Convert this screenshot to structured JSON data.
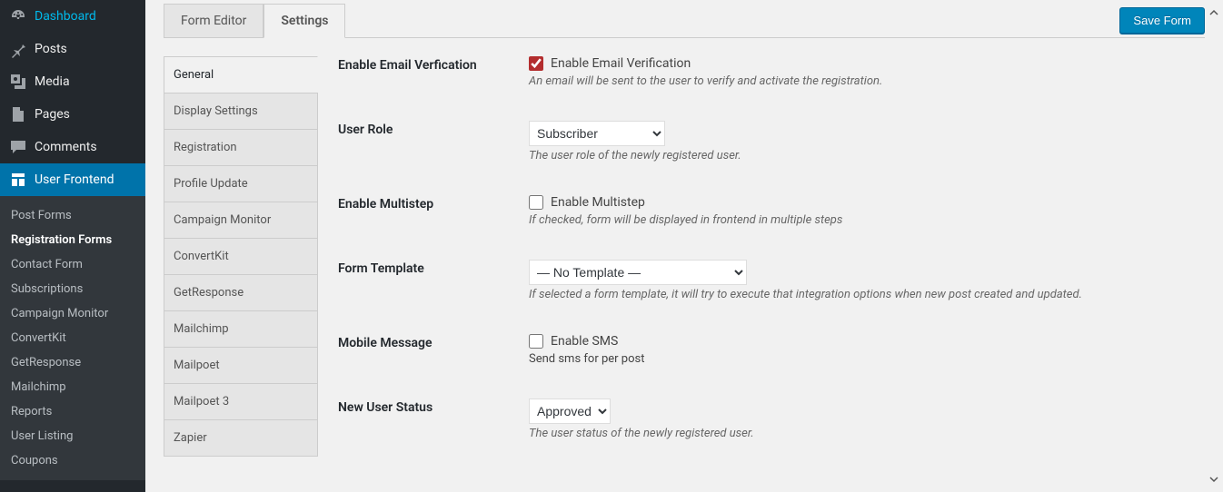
{
  "sidebar": {
    "items": [
      {
        "label": "Dashboard"
      },
      {
        "label": "Posts"
      },
      {
        "label": "Media"
      },
      {
        "label": "Pages"
      },
      {
        "label": "Comments"
      },
      {
        "label": "User Frontend"
      }
    ],
    "sub": [
      {
        "label": "Post Forms"
      },
      {
        "label": "Registration Forms",
        "current": true
      },
      {
        "label": "Contact Form"
      },
      {
        "label": "Subscriptions"
      },
      {
        "label": "Campaign Monitor"
      },
      {
        "label": "ConvertKit"
      },
      {
        "label": "GetResponse"
      },
      {
        "label": "Mailchimp"
      },
      {
        "label": "Reports"
      },
      {
        "label": "User Listing"
      },
      {
        "label": "Coupons"
      }
    ]
  },
  "tabs": {
    "form_editor": "Form Editor",
    "settings": "Settings",
    "save": "Save Form"
  },
  "settings_nav": [
    "General",
    "Display Settings",
    "Registration",
    "Profile Update",
    "Campaign Monitor",
    "ConvertKit",
    "GetResponse",
    "Mailchimp",
    "Mailpoet",
    "Mailpoet 3",
    "Zapier"
  ],
  "form": {
    "email_verification": {
      "label": "Enable Email Verfication",
      "checkbox_label": "Enable Email Verification",
      "desc": "An email will be sent to the user to verify and activate the registration."
    },
    "user_role": {
      "label": "User Role",
      "value": "Subscriber",
      "desc": "The user role of the newly registered user."
    },
    "multistep": {
      "label": "Enable Multistep",
      "checkbox_label": "Enable Multistep",
      "desc": "If checked, form will be displayed in frontend in multiple steps"
    },
    "template": {
      "label": "Form Template",
      "value": "— No Template —",
      "desc": "If selected a form template, it will try to execute that integration options when new post created and updated."
    },
    "mobile_msg": {
      "label": "Mobile Message",
      "checkbox_label": "Enable SMS",
      "desc": "Send sms for per post"
    },
    "user_status": {
      "label": "New User Status",
      "value": "Approved",
      "desc": "The user status of the newly registered user."
    }
  }
}
